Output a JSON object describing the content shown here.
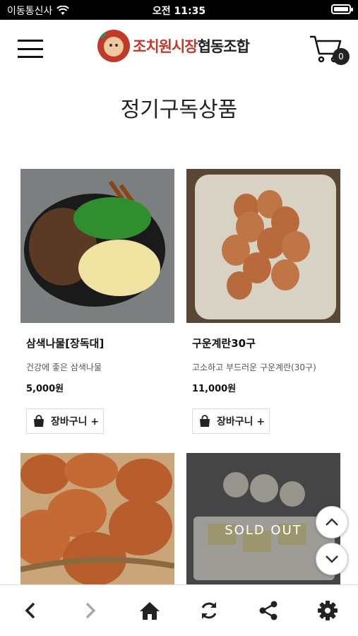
{
  "status": {
    "carrier": "이동통신사",
    "time": "오전 11:35"
  },
  "header": {
    "logo_red": "조치원시장",
    "logo_dark": "협동조합",
    "cart_count": "0"
  },
  "page_title": "정기구독상품",
  "products": [
    {
      "name": "삼색나물[장독대]",
      "desc": "건강에 좋은 삼색나물",
      "price": "5,000원",
      "button": "장바구니 +"
    },
    {
      "name": "구운계란30구",
      "desc": "고소하고 부드러운 구운계란(30구)",
      "price": "11,000원",
      "button": "장바구니 +"
    },
    {
      "name": "",
      "desc": "",
      "price": "",
      "button": ""
    },
    {
      "name": "",
      "desc": "",
      "price": "",
      "button": "",
      "overlay": "SOLD OUT"
    }
  ],
  "icons": {
    "wifi": "wifi-icon",
    "battery": "battery-icon",
    "menu": "hamburger-icon",
    "cart": "cart-icon",
    "scroll_up": "chevron-up-icon",
    "scroll_down": "chevron-down-icon",
    "back": "chevron-left-icon",
    "forward": "chevron-right-icon",
    "home": "home-icon",
    "refresh": "refresh-icon",
    "share": "share-icon",
    "settings": "gear-icon"
  },
  "colors": {
    "brand_red": "#c0392b",
    "text_dark": "#111111",
    "muted": "#555555"
  }
}
